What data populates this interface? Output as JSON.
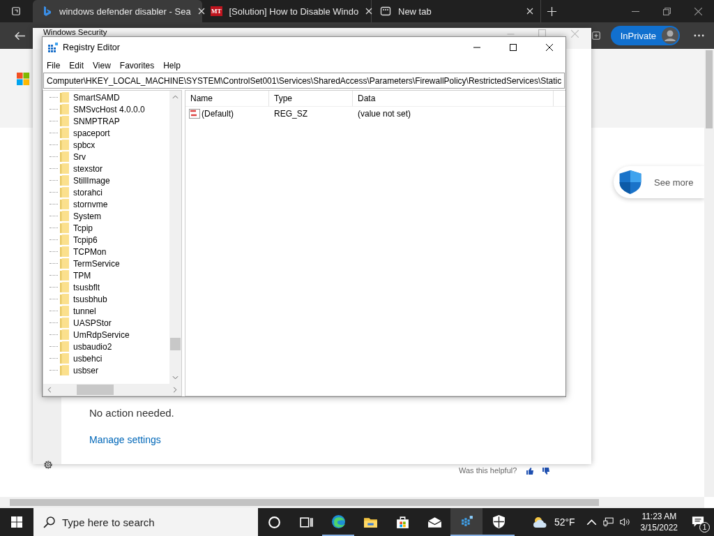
{
  "browser": {
    "tabs": [
      {
        "kind": "bing",
        "title": "windows defender disabler - Sea",
        "selected": true
      },
      {
        "kind": "mt",
        "icon_text": "MT",
        "title": "[Solution] How to Disable Windo",
        "selected": false
      },
      {
        "kind": "newtab",
        "title": "New tab",
        "selected": false
      }
    ],
    "inprivate": "InPrivate"
  },
  "page": {
    "see_more": "See more",
    "feedback": "Was this helpful?"
  },
  "security_window": {
    "title": "Windows Security",
    "status": "No action needed.",
    "link": "Manage settings"
  },
  "registry_editor": {
    "title": "Registry Editor",
    "menu": [
      "File",
      "Edit",
      "View",
      "Favorites",
      "Help"
    ],
    "address": "Computer\\HKEY_LOCAL_MACHINE\\SYSTEM\\ControlSet001\\Services\\SharedAccess\\Parameters\\FirewallPolicy\\RestrictedServices\\Static",
    "tree": [
      "SmartSAMD",
      "SMSvcHost 4.0.0.0",
      "SNMPTRAP",
      "spaceport",
      "spbcx",
      "Srv",
      "stexstor",
      "StillImage",
      "storahci",
      "stornvme",
      "System",
      "Tcpip",
      "Tcpip6",
      "TCPMon",
      "TermService",
      "TPM",
      "tsusbflt",
      "tsusbhub",
      "tunnel",
      "UASPStor",
      "UmRdpService",
      "usbaudio2",
      "usbehci",
      "usbser"
    ],
    "columns": [
      "Name",
      "Type",
      "Data"
    ],
    "values": [
      {
        "name": "(Default)",
        "type": "REG_SZ",
        "data": "(value not set)"
      }
    ]
  },
  "taskbar": {
    "search_placeholder": "Type here to search",
    "apps": [
      {
        "kind": "cortana",
        "running": false,
        "selected": false
      },
      {
        "kind": "taskview",
        "running": false,
        "selected": false
      },
      {
        "kind": "edge",
        "running": true,
        "selected": false
      },
      {
        "kind": "explorer",
        "running": false,
        "selected": false
      },
      {
        "kind": "store",
        "running": false,
        "selected": false
      },
      {
        "kind": "mail",
        "running": false,
        "selected": false
      },
      {
        "kind": "regedit",
        "running": true,
        "selected": true
      },
      {
        "kind": "security",
        "running": true,
        "selected": false
      }
    ],
    "temperature": "52°F",
    "time": "11:23 AM",
    "date": "3/15/2022",
    "notifications": "1"
  }
}
